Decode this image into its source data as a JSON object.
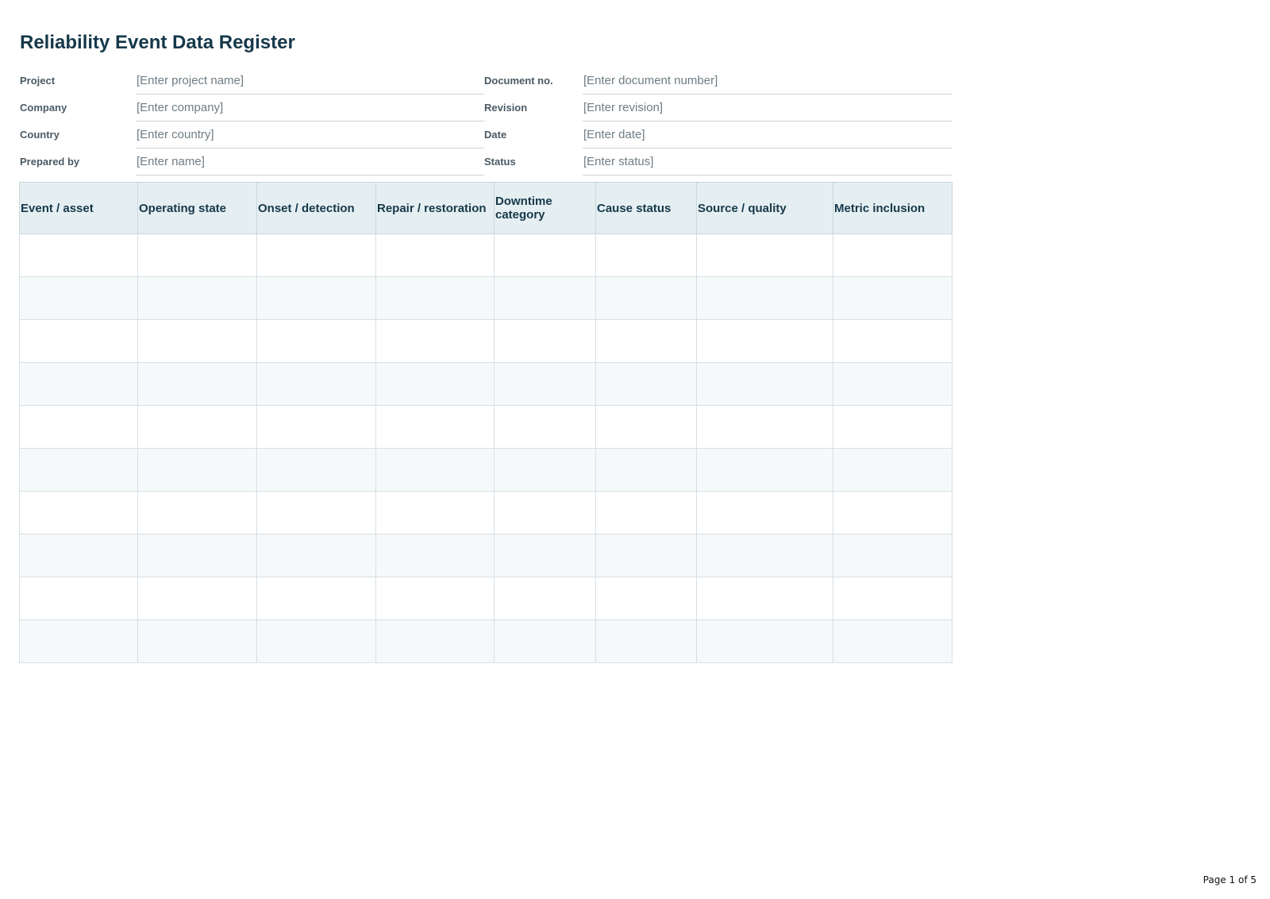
{
  "document": {
    "title": "Reliability Event Data Register"
  },
  "header_fields": {
    "project": {
      "label": "Project",
      "placeholder": "[Enter project name]"
    },
    "document_no": {
      "label": "Document no.",
      "placeholder": "[Enter document number]"
    },
    "company": {
      "label": "Company",
      "placeholder": "[Enter company]"
    },
    "revision": {
      "label": "Revision",
      "placeholder": "[Enter revision]"
    },
    "country": {
      "label": "Country",
      "placeholder": "[Enter country]"
    },
    "date": {
      "label": "Date",
      "placeholder": "[Enter date]"
    },
    "prepared_by": {
      "label": "Prepared by",
      "placeholder": "[Enter name]"
    },
    "status": {
      "label": "Status",
      "placeholder": "[Enter status]"
    }
  },
  "register": {
    "columns": [
      "Event / asset",
      "Operating state",
      "Onset / detection",
      "Repair / restoration",
      "Downtime category",
      "Cause status",
      "Source / quality",
      "Metric inclusion"
    ],
    "rows": [
      [
        "",
        "",
        "",
        "",
        "",
        "",
        "",
        ""
      ],
      [
        "",
        "",
        "",
        "",
        "",
        "",
        "",
        ""
      ],
      [
        "",
        "",
        "",
        "",
        "",
        "",
        "",
        ""
      ],
      [
        "",
        "",
        "",
        "",
        "",
        "",
        "",
        ""
      ],
      [
        "",
        "",
        "",
        "",
        "",
        "",
        "",
        ""
      ],
      [
        "",
        "",
        "",
        "",
        "",
        "",
        "",
        ""
      ],
      [
        "",
        "",
        "",
        "",
        "",
        "",
        "",
        ""
      ],
      [
        "",
        "",
        "",
        "",
        "",
        "",
        "",
        ""
      ],
      [
        "",
        "",
        "",
        "",
        "",
        "",
        "",
        ""
      ],
      [
        "",
        "",
        "",
        "",
        "",
        "",
        "",
        ""
      ]
    ]
  },
  "footer": {
    "page_label": "Page 1 of 5"
  }
}
